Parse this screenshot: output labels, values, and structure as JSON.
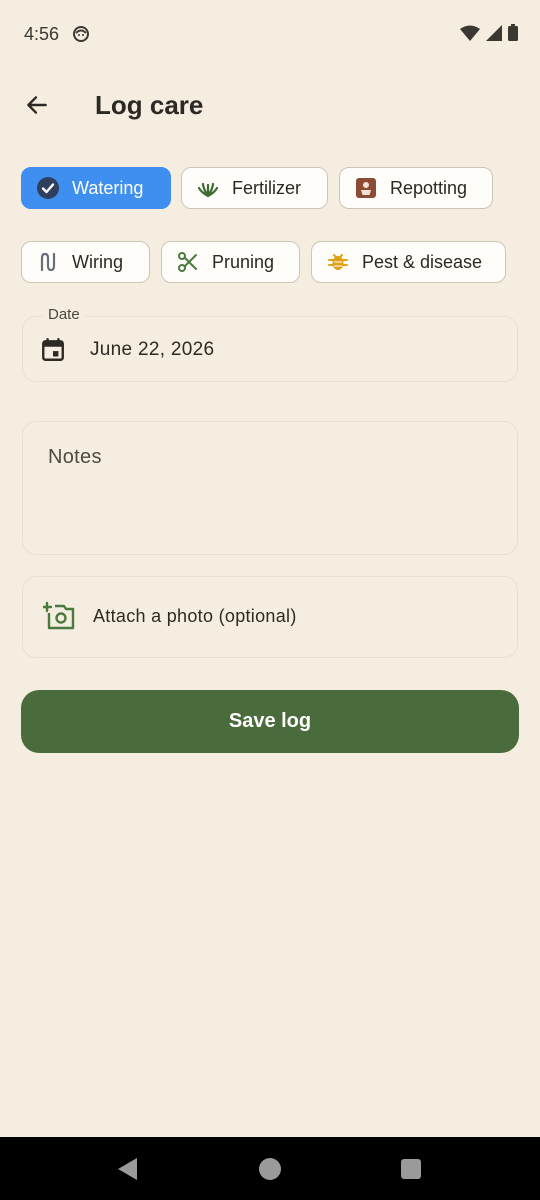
{
  "status_bar": {
    "time": "4:56"
  },
  "header": {
    "title": "Log care"
  },
  "care_types": [
    {
      "label": "Watering",
      "icon": "water-check-icon",
      "selected": true
    },
    {
      "label": "Fertilizer",
      "icon": "sprout-icon",
      "selected": false
    },
    {
      "label": "Repotting",
      "icon": "pot-flower-icon",
      "selected": false
    },
    {
      "label": "Wiring",
      "icon": "wire-icon",
      "selected": false
    },
    {
      "label": "Pruning",
      "icon": "scissors-icon",
      "selected": false
    },
    {
      "label": "Pest & disease",
      "icon": "bug-icon",
      "selected": false
    }
  ],
  "date_field": {
    "label": "Date",
    "value": "June 22, 2026"
  },
  "notes_field": {
    "placeholder": "Notes",
    "value": ""
  },
  "photo": {
    "label": "Attach a photo (optional)"
  },
  "save_button": {
    "label": "Save log"
  },
  "colors": {
    "background": "#f5ede0",
    "selected_chip": "#3f8ff0",
    "primary_button": "#4a6b3b",
    "text": "#2d2a24"
  }
}
